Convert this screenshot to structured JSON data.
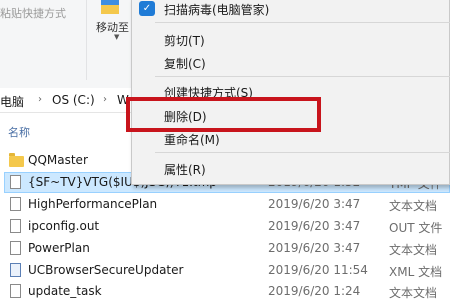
{
  "ribbon": {
    "paste_shortcut_label": "粘贴快捷方式",
    "move_to_label": "移动至",
    "move_caret": "▼"
  },
  "address": {
    "parts": [
      "电脑",
      "OS (C:)",
      "W"
    ],
    "chevron": "›"
  },
  "columns": {
    "name": "名称"
  },
  "files": [
    {
      "name": "QQMaster",
      "date": "",
      "type": "",
      "icon": "folder-icon"
    },
    {
      "name": "{SF~TV}VTG($IU$)JSG,)T1.tmp",
      "date": "2019/6/20 1:52",
      "type": "TMP 文件",
      "icon": "file-icon"
    },
    {
      "name": "HighPerformancePlan",
      "date": "2019/6/20 3:47",
      "type": "文本文档",
      "icon": "file-icon"
    },
    {
      "name": "ipconfig.out",
      "date": "2019/6/20 3:47",
      "type": "OUT 文件",
      "icon": "file-icon"
    },
    {
      "name": "PowerPlan",
      "date": "2019/6/20 3:47",
      "type": "文本文档",
      "icon": "file-icon"
    },
    {
      "name": "UCBrowserSecureUpdater",
      "date": "2019/6/20 11:54",
      "type": "XML 文档",
      "icon": "app-icon"
    },
    {
      "name": "update_task",
      "date": "2019/6/20 1:24",
      "type": "文本文档",
      "icon": "file-icon"
    }
  ],
  "context_menu": {
    "scan": "扫描病毒(电脑管家)",
    "cut": "剪切(T)",
    "copy": "复制(C)",
    "create_shortcut": "创建快捷方式(S)",
    "delete": "删除(D)",
    "rename": "重命名(M)",
    "properties": "属性(R)"
  },
  "colors": {
    "highlight_border": "#c8141c",
    "selection": "#cce8ff",
    "menu_bg": "#f2f2f2"
  }
}
